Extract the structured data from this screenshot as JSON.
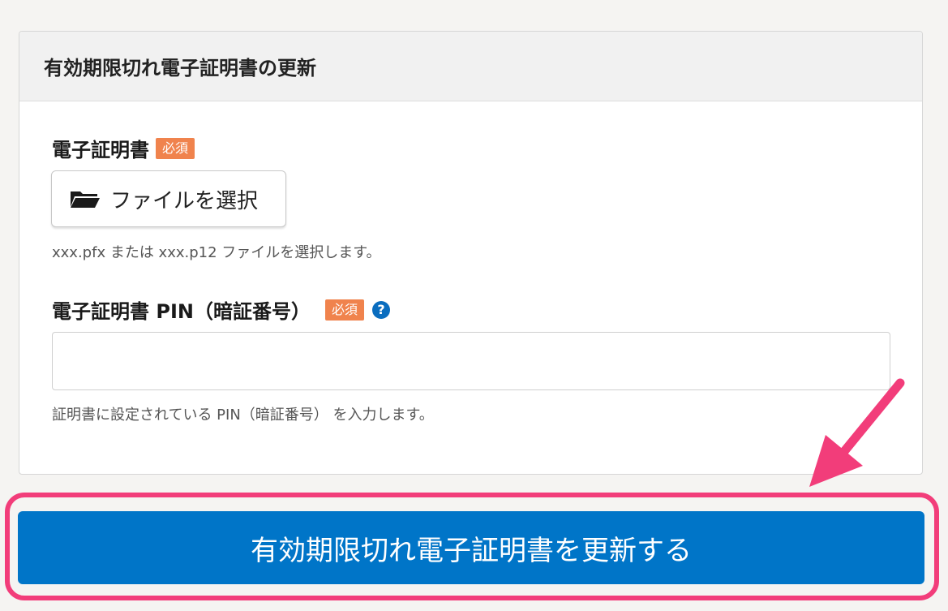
{
  "panel": {
    "title": "有効期限切れ電子証明書の更新"
  },
  "certificate_field": {
    "label": "電子証明書",
    "required_badge": "必須",
    "file_button_label": "ファイルを選択",
    "hint": "xxx.pfx または xxx.p12 ファイルを選択します。"
  },
  "pin_field": {
    "label": "電子証明書 PIN（暗証番号）",
    "required_badge": "必須",
    "help_symbol": "?",
    "value": "",
    "hint": "証明書に設定されている PIN（暗証番号） を入力します。"
  },
  "submit": {
    "label": "有効期限切れ電子証明書を更新する"
  },
  "icons": {
    "folder": "folder-open-icon",
    "help": "question-circle-icon",
    "annotation_arrow": "arrow-annotation"
  },
  "colors": {
    "primary_button": "#0075c8",
    "required_badge": "#f0834d",
    "highlight": "#f23d7a",
    "help_icon": "#0a6dbf"
  }
}
